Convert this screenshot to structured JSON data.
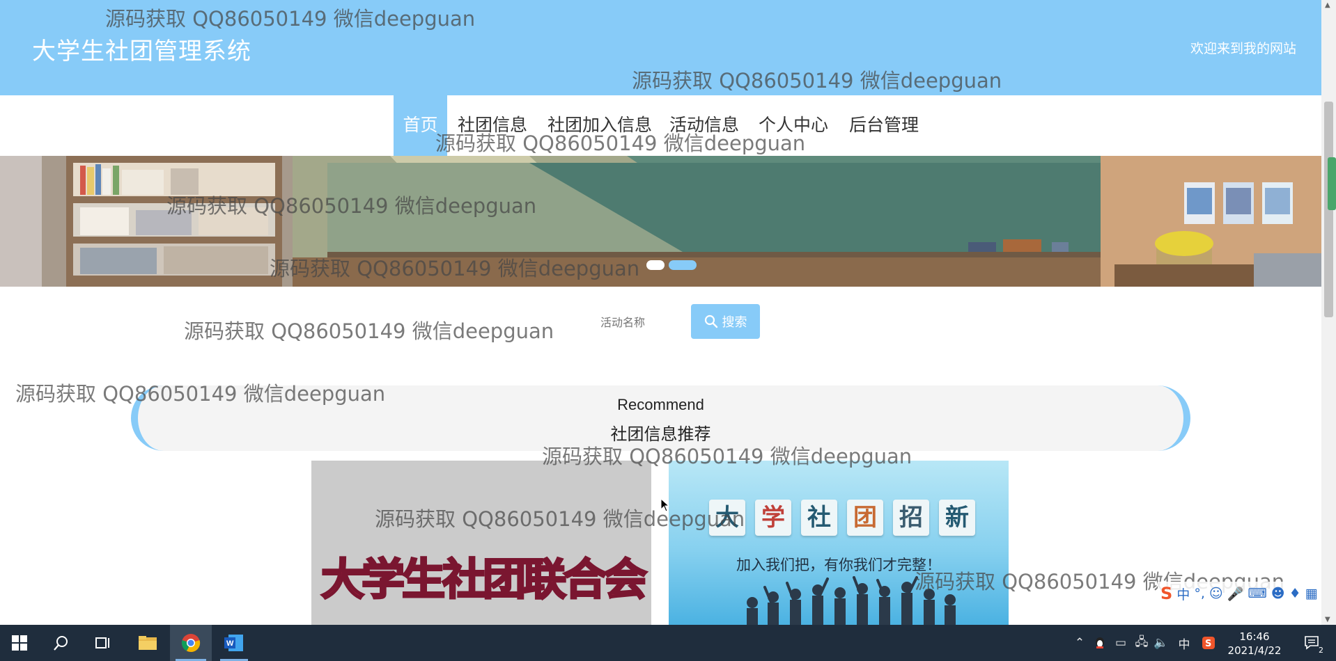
{
  "header": {
    "site_title": "大学生社团管理系统",
    "welcome": "欢迎来到我的网站"
  },
  "nav": {
    "items": [
      {
        "label": "首页",
        "active": true
      },
      {
        "label": "社团信息",
        "active": false
      },
      {
        "label": "社团加入信息",
        "active": false
      },
      {
        "label": "活动信息",
        "active": false
      },
      {
        "label": "个人中心",
        "active": false
      },
      {
        "label": "后台管理",
        "active": false
      }
    ]
  },
  "banner": {
    "current_slide": 2,
    "slide_count": 2
  },
  "search": {
    "placeholder": "活动名称",
    "button_label": "搜索"
  },
  "recommend": {
    "title_en": "Recommend",
    "title_cn": "社团信息推荐",
    "cards": [
      {
        "text": "大学生社团联合会"
      },
      {
        "tiles": [
          "大",
          "学",
          "社",
          "团",
          "招",
          "新"
        ],
        "subtitle": "加入我们把，有你我们才完整！"
      }
    ]
  },
  "watermark": "源码获取 QQ86050149 微信deepguan",
  "ime": {
    "label": "中",
    "punct": "°,"
  },
  "taskbar": {
    "tray_input_language": "中",
    "time": "16:46",
    "date": "2021/4/22",
    "notification_count": "2"
  },
  "colors": {
    "accent": "#87cbf8",
    "nav_text": "#333333",
    "taskbar": "#1f2d3d",
    "card1_text": "#c7304f"
  }
}
